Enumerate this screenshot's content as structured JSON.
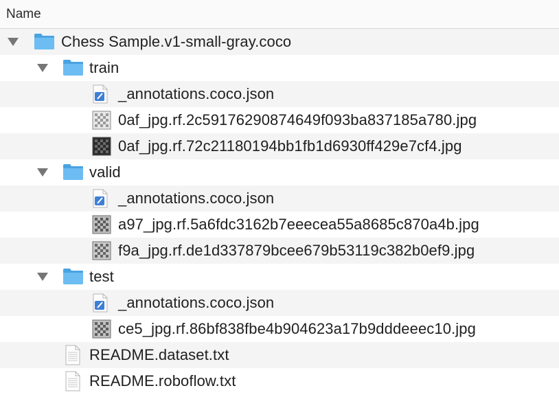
{
  "header": {
    "name_column": "Name"
  },
  "rows": [
    {
      "label": "Chess Sample.v1-small-gray.coco",
      "kind": "folder",
      "level": 0,
      "expanded": true
    },
    {
      "label": "train",
      "kind": "folder",
      "level": 1,
      "expanded": true
    },
    {
      "label": "_annotations.coco.json",
      "kind": "json",
      "level": 2
    },
    {
      "label": "0af_jpg.rf.2c59176290874649f093ba837185a780.jpg",
      "kind": "image-light",
      "level": 2
    },
    {
      "label": "0af_jpg.rf.72c21180194bb1fb1d6930ff429e7cf4.jpg",
      "kind": "image-dark",
      "level": 2
    },
    {
      "label": "valid",
      "kind": "folder",
      "level": 1,
      "expanded": true
    },
    {
      "label": "_annotations.coco.json",
      "kind": "json",
      "level": 2
    },
    {
      "label": "a97_jpg.rf.5a6fdc3162b7eeecea55a8685c870a4b.jpg",
      "kind": "image-mid",
      "level": 2
    },
    {
      "label": "f9a_jpg.rf.de1d337879bcee679b53119c382b0ef9.jpg",
      "kind": "image-mid",
      "level": 2
    },
    {
      "label": "test",
      "kind": "folder",
      "level": 1,
      "expanded": true
    },
    {
      "label": "_annotations.coco.json",
      "kind": "json",
      "level": 2
    },
    {
      "label": "ce5_jpg.rf.86bf838fbe4b904623a17b9dddeeec10.jpg",
      "kind": "image-mid",
      "level": 2
    },
    {
      "label": "README.dataset.txt",
      "kind": "text",
      "level": 1
    },
    {
      "label": "README.roboflow.txt",
      "kind": "text",
      "level": 1
    }
  ],
  "colors": {
    "folder": "#5fb4ee",
    "folder_tab": "#4aa3e2",
    "stripe": "#f4f4f5",
    "disclosure": "#767676"
  }
}
